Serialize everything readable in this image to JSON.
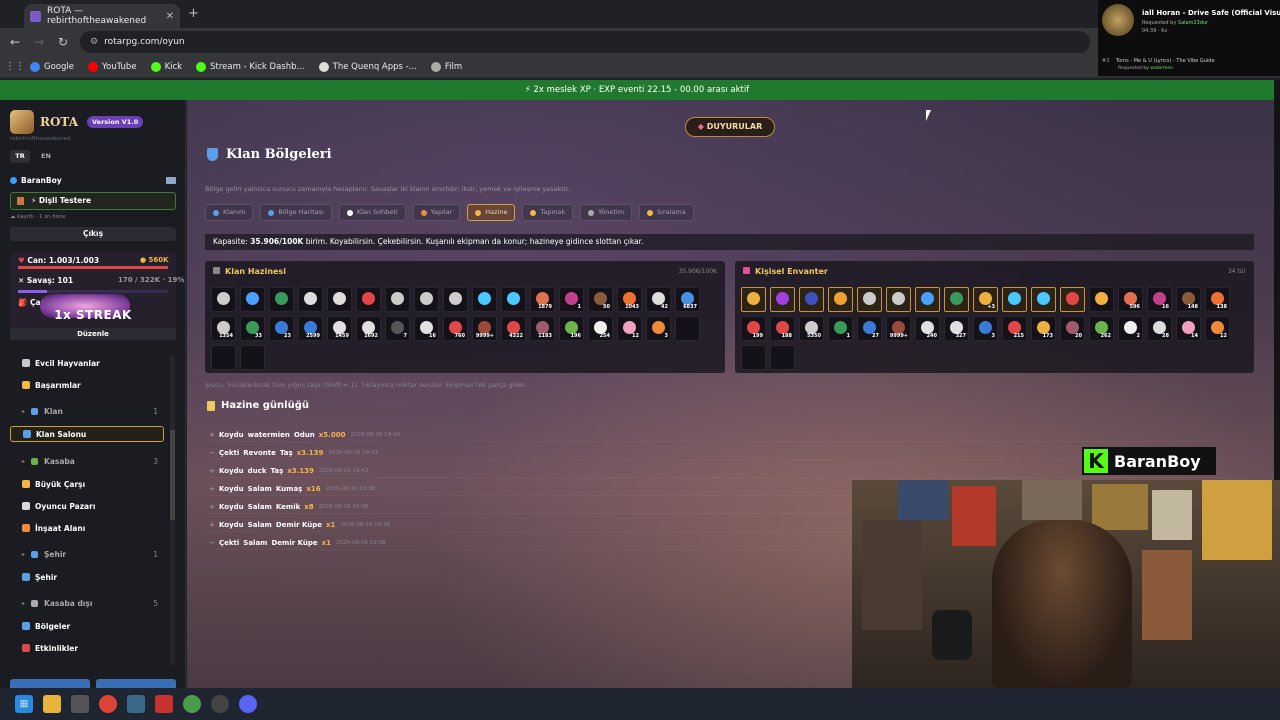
{
  "browser": {
    "tab_title": "ROTA — rebirthoftheawakened",
    "new_tab": "+",
    "url": "rotarpg.com/oyun",
    "bookmarks": [
      {
        "label": "Google",
        "color": "#4285f4"
      },
      {
        "label": "YouTube",
        "color": "#ff0000"
      },
      {
        "label": "Kick",
        "color": "#53fc18"
      },
      {
        "label": "Stream - Kick Dashb...",
        "color": "#53fc18"
      },
      {
        "label": "The Quenq Apps -...",
        "color": "#dddddd"
      },
      {
        "label": "Film",
        "color": "#aaaaaa"
      }
    ]
  },
  "music": {
    "title": "iall Horan - Drive Safe (Official Visualiser",
    "requested_prefix": "Requested by",
    "requested_by": "Salam23dur",
    "meta": "04:39 · 6x",
    "next_index": "#3",
    "next_title": "Toms - Me & U (Lyrics) - The Vibe Guide",
    "next_requested_by": "watermen"
  },
  "banner": "2x meslek XP · EXP eventi 22.15 - 00.00 arası aktif",
  "sidebar": {
    "brand": "ROTA",
    "version": "Version V1.0",
    "username": "rebirthoftheawakened",
    "lang_tr": "TR",
    "lang_en": "EN",
    "player": "BaranBoy",
    "equipped": "Dişli Testere",
    "status": "kayıtlı · 1 sn önce",
    "logout": "Çıkış",
    "can": "Can: 1.003/1.003",
    "gold": "560K",
    "hp_fraction": 1.0,
    "savas": "Savaş: 101",
    "xp": "170 / 322K · 19%",
    "xp_fraction": 0.19,
    "calisma": "Çanta: 3",
    "streak": "1x STREAK",
    "edit": "Düzenle",
    "nav": [
      {
        "type": "item",
        "label": "Evcil Hayvanlar",
        "icon_color": "#c9c9c9"
      },
      {
        "type": "item",
        "label": "Başarımlar",
        "icon_color": "#f5b642"
      },
      {
        "type": "group",
        "label": "Klan",
        "count": "1",
        "icon_color": "#5aa0e8"
      },
      {
        "type": "item",
        "label": "Klan Salonu",
        "icon_color": "#5aa0e8",
        "active": true
      },
      {
        "type": "group",
        "label": "Kasaba",
        "count": "3",
        "icon_color": "#6bb34a"
      },
      {
        "type": "item",
        "label": "Büyük Çarşı",
        "icon_color": "#f5b642"
      },
      {
        "type": "item",
        "label": "Oyuncu Pazarı",
        "icon_color": "#d9d9d9"
      },
      {
        "type": "item",
        "label": "İnşaat Alanı",
        "icon_color": "#f08a3a"
      },
      {
        "type": "group",
        "label": "Şehir",
        "count": "1",
        "icon_color": "#5aa0e8"
      },
      {
        "type": "item",
        "label": "Şehir",
        "icon_color": "#5aa0e8"
      },
      {
        "type": "group",
        "label": "Kasaba dışı",
        "count": "5",
        "icon_color": "#aaaaaa"
      },
      {
        "type": "item",
        "label": "Bölgeler",
        "icon_color": "#5aa0e8"
      },
      {
        "type": "item",
        "label": "Etkinlikler",
        "icon_color": "#e24747"
      }
    ]
  },
  "main": {
    "announcement": "DUYURULAR",
    "title": "Klan Bölgeleri",
    "description": "Bölge geliri yalnızca sunucu zamanıyla hesaplanır. Savaşlar iki klanın sınırlıdır: iksir, yemek ve iyileşme yasaktır.",
    "tabs": [
      {
        "label": "Klanım",
        "color": "#5aa0e8"
      },
      {
        "label": "Bölge Haritası",
        "color": "#5aa0e8"
      },
      {
        "label": "Klan Sohbeti",
        "color": "#ffffff"
      },
      {
        "label": "Yapılar",
        "color": "#f08a3a"
      },
      {
        "label": "Hazine",
        "color": "#f5b642",
        "active": true
      },
      {
        "label": "Tapınak",
        "color": "#f5b642"
      },
      {
        "label": "Yönetim",
        "color": "#aaaaaa"
      },
      {
        "label": "Sıralama",
        "color": "#f5b642"
      }
    ],
    "capacity_label": "Kapasite:",
    "capacity_value": "35.906/100K",
    "capacity_rest": "birim. Koyabilirsin. Çekebilirsin. Kuşanılı ekipman da konur; hazineye gidince slottan çıkar.",
    "treasury": {
      "title": "Klan Hazinesi",
      "capacity": "35.906/100K",
      "cells": [
        {
          "c": "#cccccc",
          "q": ""
        },
        {
          "c": "#4aa0ff",
          "q": ""
        },
        {
          "c": "#3a9a5a",
          "q": ""
        },
        {
          "c": "#dddddd",
          "q": ""
        },
        {
          "c": "#dddddd",
          "q": ""
        },
        {
          "c": "#e24747",
          "q": ""
        },
        {
          "c": "#cccccc",
          "q": ""
        },
        {
          "c": "#cccccc",
          "q": ""
        },
        {
          "c": "#cccccc",
          "q": ""
        },
        {
          "c": "#4ac8ff",
          "q": ""
        },
        {
          "c": "#4ac8ff",
          "q": ""
        },
        {
          "c": "#e07050",
          "q": "1879"
        },
        {
          "c": "#c0408a",
          "q": "1"
        },
        {
          "c": "#8a5a3a",
          "q": "50"
        },
        {
          "c": "#f07030",
          "q": "1043"
        },
        {
          "c": "#dddddd",
          "q": "42"
        },
        {
          "c": "#4a90e0",
          "q": "6837"
        },
        {
          "c": "#cccccc",
          "q": "1354"
        },
        {
          "c": "#3a9a5a",
          "q": "33"
        },
        {
          "c": "#3a7ad9",
          "q": "23"
        },
        {
          "c": "#3a7ad9",
          "q": "2599"
        },
        {
          "c": "#e0e0e0",
          "q": "1459"
        },
        {
          "c": "#e0e0e0",
          "q": "1692"
        },
        {
          "c": "#555555",
          "q": "7"
        },
        {
          "c": "#e0e0e0",
          "q": "16"
        },
        {
          "c": "#e24747",
          "q": "760"
        },
        {
          "c": "#9a4a3a",
          "q": "9999+"
        },
        {
          "c": "#e24747",
          "q": "4322"
        },
        {
          "c": "#a05a6a",
          "q": "1183"
        },
        {
          "c": "#6bb34a",
          "q": "196"
        },
        {
          "c": "#f0f0f0",
          "q": "254"
        },
        {
          "c": "#f0a0c0",
          "q": "12"
        },
        {
          "c": "#f08a3a",
          "q": "3"
        },
        {
          "c": "",
          "q": ""
        },
        {
          "c": "",
          "q": ""
        },
        {
          "c": "",
          "q": ""
        }
      ]
    },
    "inventory": {
      "title": "Kişisel Envanter",
      "count": "34 tür",
      "cells": [
        {
          "c": "#f0b040",
          "q": "",
          "h": true
        },
        {
          "c": "#a040e0",
          "q": "",
          "h": true
        },
        {
          "c": "#4050c0",
          "q": "",
          "h": true
        },
        {
          "c": "#f0a030",
          "q": "",
          "h": true
        },
        {
          "c": "#cccccc",
          "q": "",
          "h": true
        },
        {
          "c": "#cccccc",
          "q": "",
          "h": true
        },
        {
          "c": "#4aa0ff",
          "q": "",
          "h": true
        },
        {
          "c": "#3a9a5a",
          "q": "",
          "h": true
        },
        {
          "c": "#f0b040",
          "q": "+3",
          "h": true
        },
        {
          "c": "#4ac8ff",
          "q": "",
          "h": true
        },
        {
          "c": "#4ac8ff",
          "q": "",
          "h": true
        },
        {
          "c": "#e24747",
          "q": "",
          "h": true
        },
        {
          "c": "#f0b040",
          "q": ""
        },
        {
          "c": "#e07050",
          "q": "596"
        },
        {
          "c": "#c0408a",
          "q": "16"
        },
        {
          "c": "#8a5a3a",
          "q": "148"
        },
        {
          "c": "#f07030",
          "q": "138"
        },
        {
          "c": "#e24747",
          "q": "199"
        },
        {
          "c": "#e24747",
          "q": "188"
        },
        {
          "c": "#cccccc",
          "q": "5350"
        },
        {
          "c": "#3a9a5a",
          "q": "1"
        },
        {
          "c": "#3a7ad9",
          "q": "27"
        },
        {
          "c": "#9a4a3a",
          "q": "9999+"
        },
        {
          "c": "#e0e0e0",
          "q": "240"
        },
        {
          "c": "#e0e0e0",
          "q": "327"
        },
        {
          "c": "#3a7ad9",
          "q": "3"
        },
        {
          "c": "#e24747",
          "q": "215"
        },
        {
          "c": "#f0b040",
          "q": "173"
        },
        {
          "c": "#a05a6a",
          "q": "20"
        },
        {
          "c": "#6bb34a",
          "q": "262"
        },
        {
          "c": "#f0f0f0",
          "q": "2"
        },
        {
          "c": "#dddddd",
          "q": "28"
        },
        {
          "c": "#f0a0c0",
          "q": "14"
        },
        {
          "c": "#f08a3a",
          "q": "12"
        },
        {
          "c": "",
          "q": ""
        },
        {
          "c": "",
          "q": ""
        }
      ]
    },
    "tip": "İpucu: Sürükle-bırak tüm yığını taşır (Shift = 1). Tıklayınca miktar sorulur. Ekipman tek parça gider.",
    "log_title": "Hazine günlüğü",
    "log": [
      {
        "sign": "+",
        "action": "Koydu",
        "user": "watermien",
        "item": "Odun",
        "qty": "x5.000",
        "date": "2026-08-16 19:49"
      },
      {
        "sign": "−",
        "action": "Çekti",
        "user": "Revonte",
        "item": "Taş",
        "qty": "x3.139",
        "date": "2026-08-16 19:43"
      },
      {
        "sign": "+",
        "action": "Koydu",
        "user": "duck",
        "item": "Taş",
        "qty": "x3.139",
        "date": "2026-08-16 19:43"
      },
      {
        "sign": "+",
        "action": "Koydu",
        "user": "Salam",
        "item": "Kumaş",
        "qty": "x16",
        "date": "2026-08-16 19:38"
      },
      {
        "sign": "+",
        "action": "Koydu",
        "user": "Salam",
        "item": "Kemik",
        "qty": "x8",
        "date": "2026-08-16 19:38"
      },
      {
        "sign": "+",
        "action": "Koydu",
        "user": "Salam",
        "item": "Demir Küpe",
        "qty": "x1",
        "date": "2026-08-16 19:38"
      },
      {
        "sign": "−",
        "action": "Çekti",
        "user": "Salam",
        "item": "Demir Küpe",
        "qty": "x1",
        "date": "2026-08-16 19:38"
      }
    ]
  },
  "stream": {
    "channel": "BaranBoy",
    "k": "K"
  }
}
